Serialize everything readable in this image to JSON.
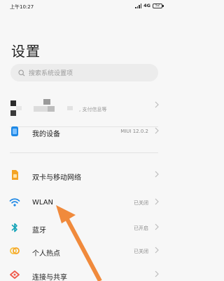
{
  "status_bar": {
    "time": "上午10:27",
    "network": "4G",
    "battery": "52"
  },
  "page": {
    "title": "设置"
  },
  "search": {
    "placeholder": "搜索系统设置项"
  },
  "account": {
    "subtitle": ", 支付信息等"
  },
  "device": {
    "label": "我的设备",
    "value": "MIUI 12.0.2"
  },
  "settings": [
    {
      "id": "sim",
      "label": "双卡与移动网络",
      "value": ""
    },
    {
      "id": "wlan",
      "label": "WLAN",
      "value": "已关闭"
    },
    {
      "id": "bluetooth",
      "label": "蓝牙",
      "value": "已开启"
    },
    {
      "id": "hotspot",
      "label": "个人热点",
      "value": "已关闭"
    },
    {
      "id": "connection",
      "label": "连接与共享",
      "value": ""
    }
  ],
  "colors": {
    "accent_arrow": "#f08a3c",
    "icon_blue": "#1e88e5",
    "icon_teal": "#16a4b8",
    "icon_orange": "#f4a425",
    "icon_yellow": "#f6c343",
    "icon_red": "#ef5b4c"
  },
  "icons": {
    "search": "search-icon",
    "device": "phone-icon",
    "sim": "sim-card-icon",
    "wlan": "wifi-icon",
    "bluetooth": "bluetooth-icon",
    "hotspot": "hotspot-icon",
    "connection": "share-icon",
    "chevron": "chevron-right-icon"
  }
}
